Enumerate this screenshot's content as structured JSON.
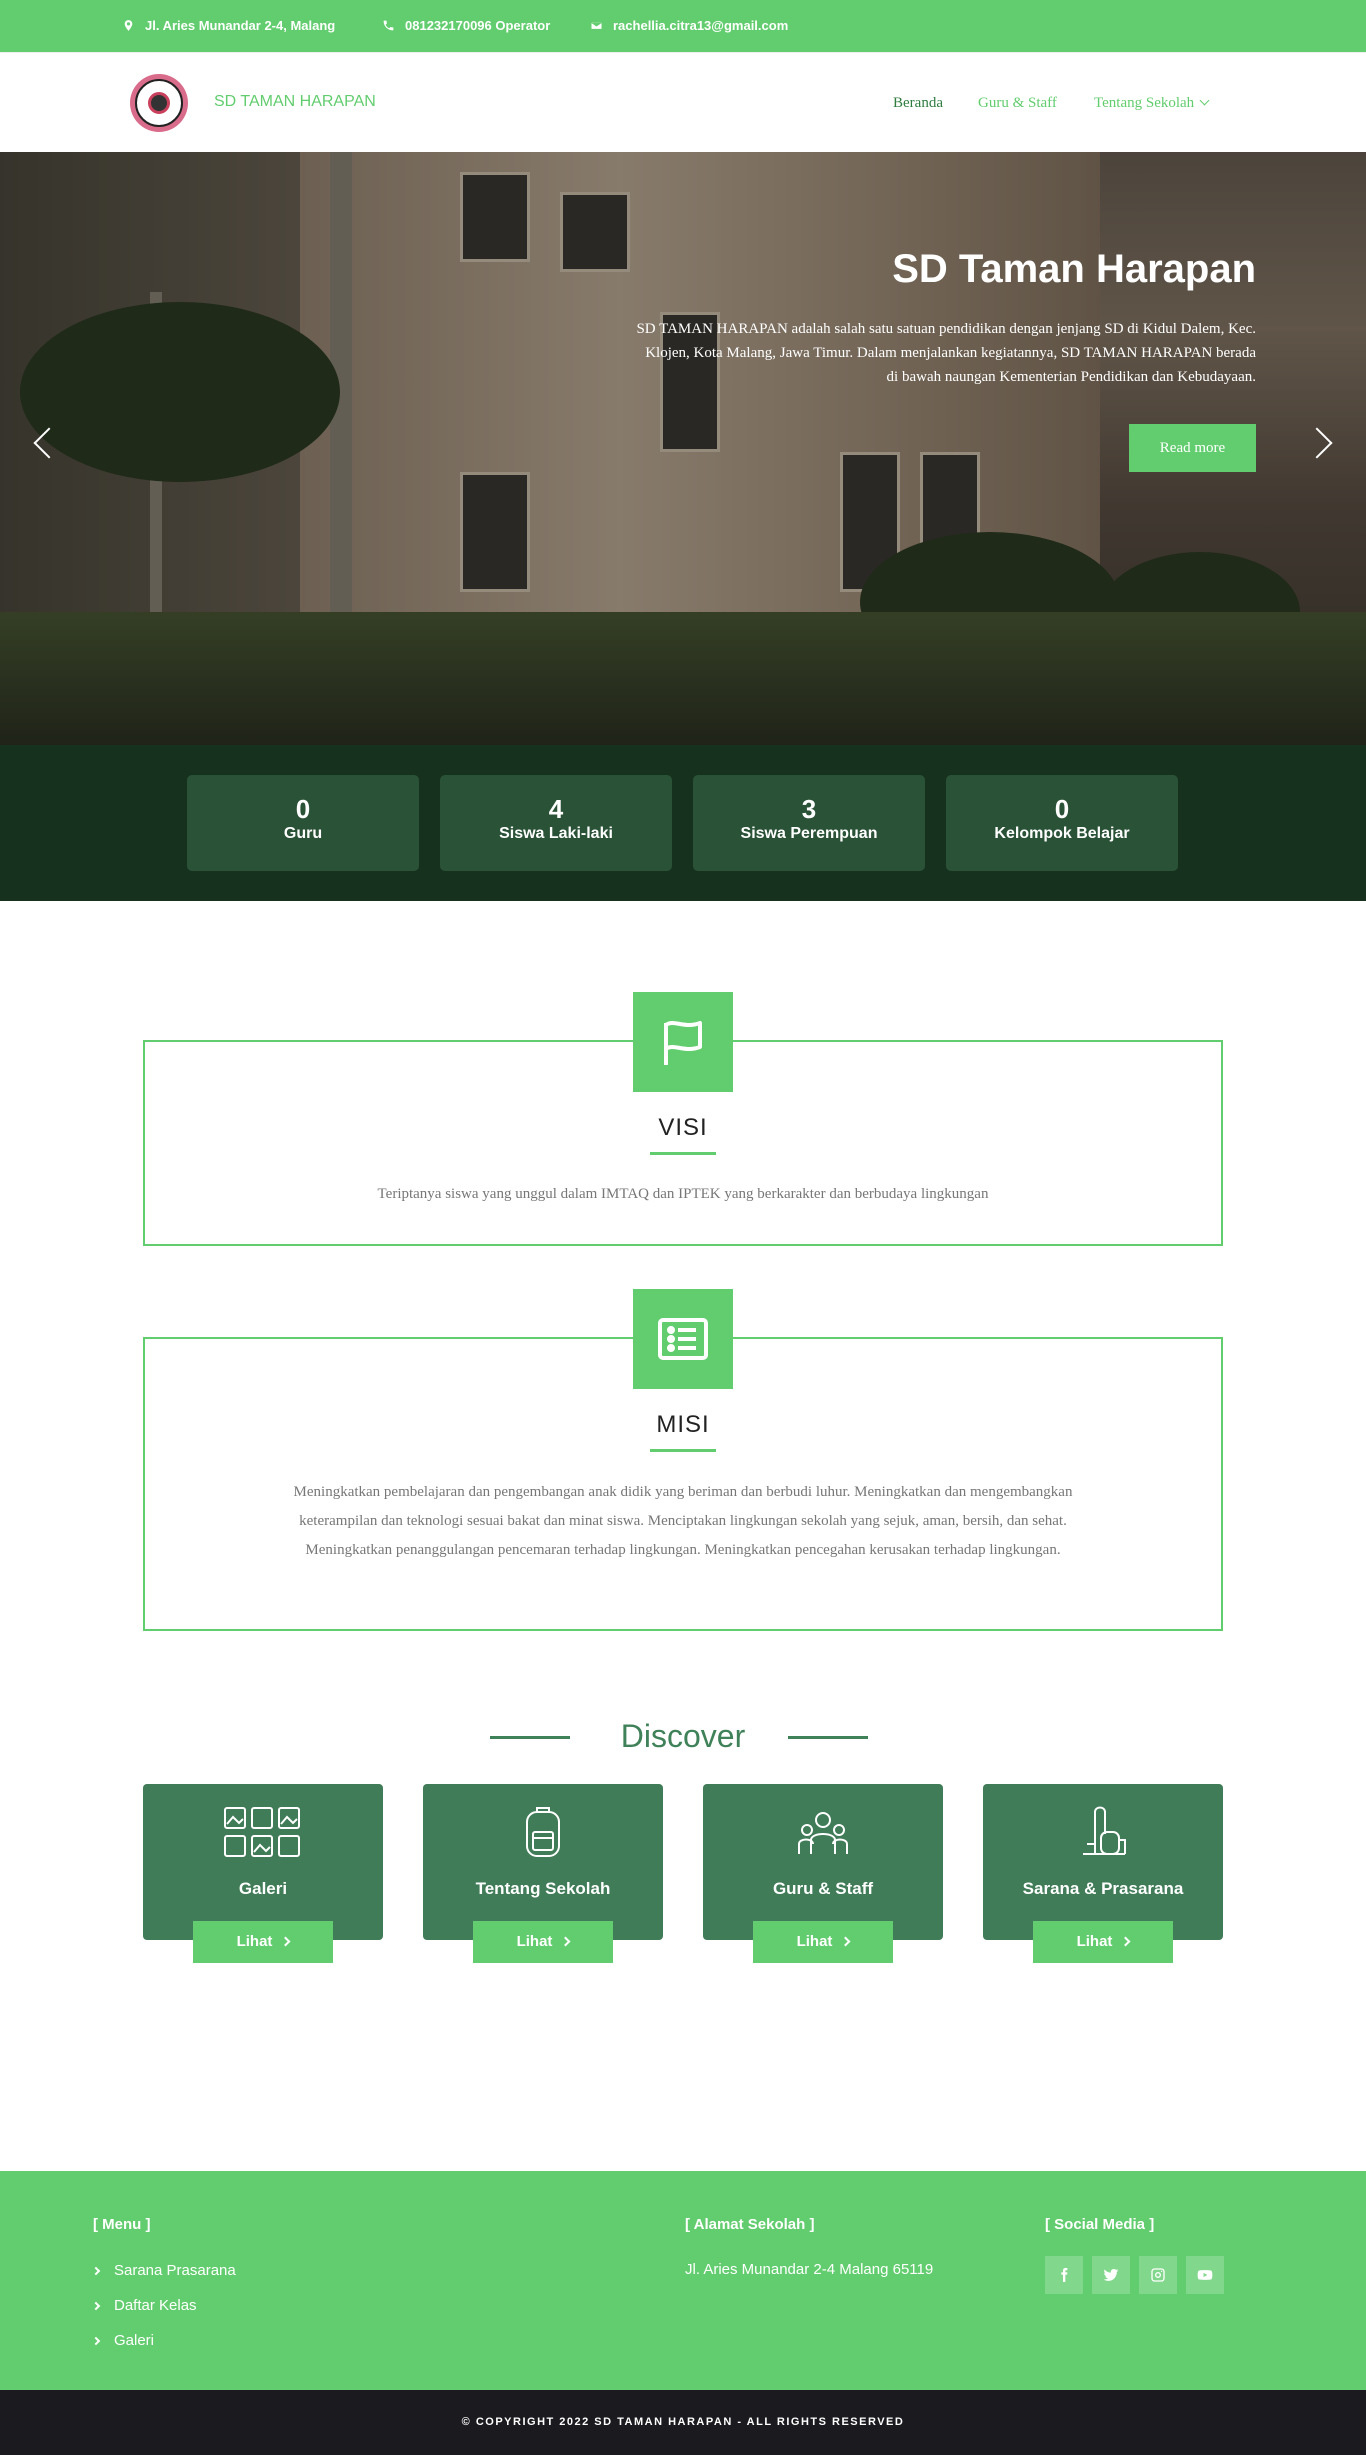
{
  "topbar": {
    "address": "Jl. Aries Munandar 2-4, Malang",
    "phone": "081232170096 Operator",
    "email": "rachellia.citra13@gmail.com"
  },
  "header": {
    "brand": "SD TAMAN HARAPAN",
    "nav": [
      "Beranda",
      "Guru & Staff",
      "Tentang Sekolah"
    ]
  },
  "hero": {
    "title": "SD Taman Harapan",
    "description": "SD TAMAN HARAPAN adalah salah satu satuan pendidikan dengan jenjang SD di Kidul Dalem, Kec. Klojen, Kota Malang, Jawa Timur. Dalam menjalankan kegiatannya, SD TAMAN HARAPAN berada di bawah naungan Kementerian Pendidikan dan Kebudayaan.",
    "button": "Read more"
  },
  "stats": [
    {
      "value": "0",
      "label": "Guru"
    },
    {
      "value": "4",
      "label": "Siswa Laki-laki"
    },
    {
      "value": "3",
      "label": "Siswa Perempuan"
    },
    {
      "value": "0",
      "label": "Kelompok Belajar"
    }
  ],
  "visi": {
    "title": "VISI",
    "text": "Teriptanya siswa yang unggul dalam IMTAQ dan IPTEK yang berkarakter dan berbudaya lingkungan"
  },
  "misi": {
    "title": "MISI",
    "text": "Meningkatkan pembelajaran dan pengembangan anak didik yang beriman dan berbudi luhur. Meningkatkan dan mengembangkan keterampilan dan teknologi sesuai bakat dan minat siswa. Menciptakan lingkungan sekolah yang sejuk, aman, bersih, dan sehat. Meningkatkan penanggulangan pencemaran terhadap lingkungan. Meningkatkan pencegahan kerusakan terhadap lingkungan."
  },
  "discover": {
    "title": "Discover",
    "cards": [
      {
        "title": "Galeri",
        "button": "Lihat"
      },
      {
        "title": "Tentang Sekolah",
        "button": "Lihat"
      },
      {
        "title": "Guru & Staff",
        "button": "Lihat"
      },
      {
        "title": "Sarana & Prasarana",
        "button": "Lihat"
      }
    ]
  },
  "footer": {
    "menu_heading": "[ Menu ]",
    "menu": [
      "Sarana Prasarana",
      "Daftar Kelas",
      "Galeri"
    ],
    "address_heading": "[ Alamat Sekolah ]",
    "address": "Jl. Aries Munandar 2-4 Malang 65119",
    "social_heading": "[ Social Media ]",
    "social": [
      "facebook-icon",
      "twitter-icon",
      "instagram-icon",
      "youtube-icon"
    ],
    "copyright": "© COPYRIGHT 2022 SD TAMAN HARAPAN - ALL RIGHTS RESERVED"
  },
  "colors": {
    "accent": "#62cd6e",
    "dark_green": "#17311f",
    "card_green": "#3f7c57",
    "footer_bottom": "#1a1a1f"
  }
}
